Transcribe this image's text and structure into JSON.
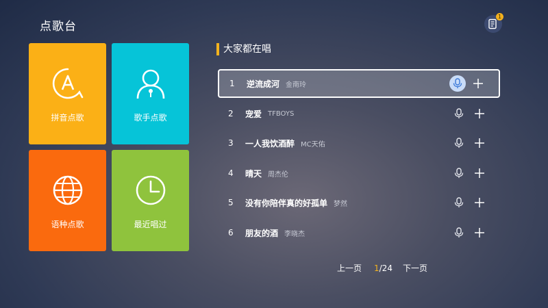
{
  "header": {
    "title": "点歌台",
    "notification_badge": "1",
    "notification_icon": "song-list-icon"
  },
  "tiles": [
    {
      "label": "拼音点歌",
      "icon": "pinyin-a-icon",
      "color": "#fbb016"
    },
    {
      "label": "歌手点歌",
      "icon": "singer-icon",
      "color": "#06c4d8"
    },
    {
      "label": "语种点歌",
      "icon": "globe-icon",
      "color": "#fa6a0e"
    },
    {
      "label": "最近唱过",
      "icon": "clock-icon",
      "color": "#8fc33d"
    }
  ],
  "section": {
    "title": "大家都在唱",
    "accent": "#f4b31e"
  },
  "songs": [
    {
      "num": "1",
      "title": "逆流成河",
      "artist": "金南玲"
    },
    {
      "num": "2",
      "title": "宠爱",
      "artist": "TFBOYS"
    },
    {
      "num": "3",
      "title": "一人我饮酒醉",
      "artist": "MC天佑"
    },
    {
      "num": "4",
      "title": "晴天",
      "artist": "周杰伦"
    },
    {
      "num": "5",
      "title": "没有你陪伴真的好孤单",
      "artist": "梦然"
    },
    {
      "num": "6",
      "title": "朋友的酒",
      "artist": "李晓杰"
    }
  ],
  "pager": {
    "prev_label": "上一页",
    "current": "1",
    "total": "/24",
    "next_label": "下一页"
  }
}
